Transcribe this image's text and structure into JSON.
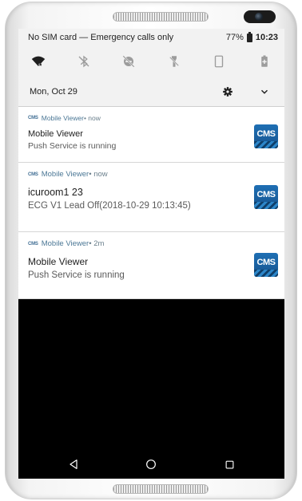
{
  "status_bar": {
    "carrier_text": "No SIM card — Emergency calls only",
    "battery": "77%",
    "time": "10:23"
  },
  "quick_settings": {
    "tiles": [
      {
        "name": "wifi",
        "icon": "wifi-icon"
      },
      {
        "name": "bluetooth",
        "icon": "bluetooth-off-icon"
      },
      {
        "name": "do-not-disturb",
        "icon": "dnd-icon"
      },
      {
        "name": "flashlight",
        "icon": "flashlight-icon"
      },
      {
        "name": "rotation",
        "icon": "phone-rotation-icon"
      },
      {
        "name": "battery-saver",
        "icon": "battery-saver-icon"
      }
    ],
    "date": "Mon, Oct 29"
  },
  "notifications": [
    {
      "app_icon_text": "CMS",
      "app_name": "Mobile Viewer",
      "when": " • now",
      "title": "Mobile Viewer",
      "text": "Push Service is running",
      "logo_text": "CMS"
    },
    {
      "app_icon_text": "CMS",
      "app_name": "Mobile Viewer",
      "when": " • now",
      "title": "icuroom1 23",
      "text": "ECG V1 Lead Off(2018-10-29 10:13:45)",
      "logo_text": "CMS"
    },
    {
      "app_icon_text": "CMS",
      "app_name": "Mobile Viewer",
      "when": " • 2m",
      "title": "Mobile Viewer",
      "text": "Push Service is running",
      "logo_text": "CMS"
    }
  ],
  "navigation": {
    "buttons": [
      "back-icon",
      "home-icon",
      "recents-icon"
    ]
  }
}
